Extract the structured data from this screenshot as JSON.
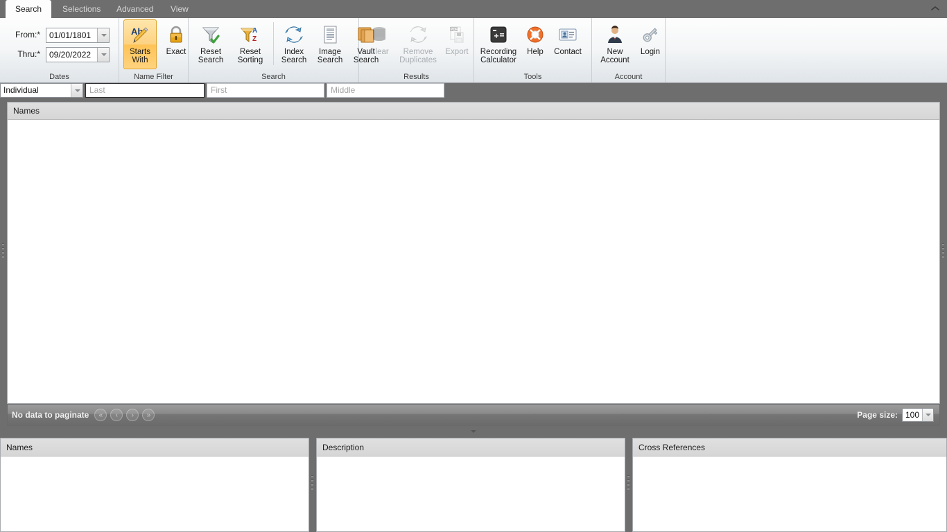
{
  "window": {
    "ribbon_collapse_icon": "chevron-up-icon"
  },
  "tabs": [
    {
      "label": "Search",
      "active": true
    },
    {
      "label": "Selections",
      "active": false
    },
    {
      "label": "Advanced",
      "active": false
    },
    {
      "label": "View",
      "active": false
    }
  ],
  "ribbon": {
    "groups": [
      {
        "name": "dates",
        "label": "Dates"
      },
      {
        "name": "name-filter",
        "label": "Name Filter"
      },
      {
        "name": "search",
        "label": "Search"
      },
      {
        "name": "results",
        "label": "Results"
      },
      {
        "name": "tools",
        "label": "Tools"
      },
      {
        "name": "account",
        "label": "Account"
      }
    ],
    "dates": {
      "from_label": "From:*",
      "from_value": "01/01/1801",
      "thru_label": "Thru:*",
      "thru_value": "09/20/2022"
    },
    "name_filter": {
      "starts_with": {
        "label": "Starts\nWith",
        "icon": "ab-pencil-icon",
        "active": true
      },
      "exact": {
        "label": "Exact",
        "icon": "padlock-icon",
        "active": false
      }
    },
    "search": {
      "reset_search": {
        "label": "Reset\nSearch",
        "icon": "funnel-check-icon"
      },
      "reset_sorting": {
        "label": "Reset\nSorting",
        "icon": "funnel-az-icon"
      },
      "index_search": {
        "label": "Index\nSearch",
        "icon": "refresh-arrows-icon"
      },
      "image_search": {
        "label": "Image\nSearch",
        "icon": "document-lines-icon"
      },
      "vault_search": {
        "label": "Vault\nSearch",
        "icon": "books-icon"
      }
    },
    "results": {
      "clear": {
        "label": "Clear",
        "icon": "trash-can-icon",
        "disabled": true
      },
      "remove_duplicates": {
        "label": "Remove\nDuplicates",
        "icon": "recycle-arrows-icon",
        "disabled": true
      },
      "export": {
        "label": "Export",
        "icon": "pdf-save-icon",
        "disabled": true
      }
    },
    "tools": {
      "recording_calculator": {
        "label": "Recording\nCalculator",
        "icon": "calculator-icon"
      },
      "help": {
        "label": "Help",
        "icon": "lifebuoy-icon"
      },
      "contact": {
        "label": "Contact",
        "icon": "contact-card-icon"
      }
    },
    "account": {
      "new_account": {
        "label": "New\nAccount",
        "icon": "person-suit-icon"
      },
      "login": {
        "label": "Login",
        "icon": "key-icon"
      }
    }
  },
  "criteria": {
    "type_select": {
      "value": "Individual"
    },
    "last": {
      "value": "",
      "placeholder": "Last",
      "focused": true
    },
    "first": {
      "value": "",
      "placeholder": "First",
      "focused": false
    },
    "middle": {
      "value": "",
      "placeholder": "Middle",
      "focused": false
    }
  },
  "results_grid": {
    "column_header": "Names",
    "rows": []
  },
  "pager": {
    "message": "No data to paginate",
    "first_icon": "double-chevron-left-icon",
    "prev_icon": "chevron-left-icon",
    "next_icon": "chevron-right-icon",
    "last_icon": "double-chevron-right-icon",
    "page_size_label": "Page size:",
    "page_size_value": "100"
  },
  "bottom_panels": [
    {
      "name": "names",
      "title": "Names",
      "rows": []
    },
    {
      "name": "description",
      "title": "Description",
      "rows": []
    },
    {
      "name": "cross-references",
      "title": "Cross References",
      "rows": []
    }
  ]
}
